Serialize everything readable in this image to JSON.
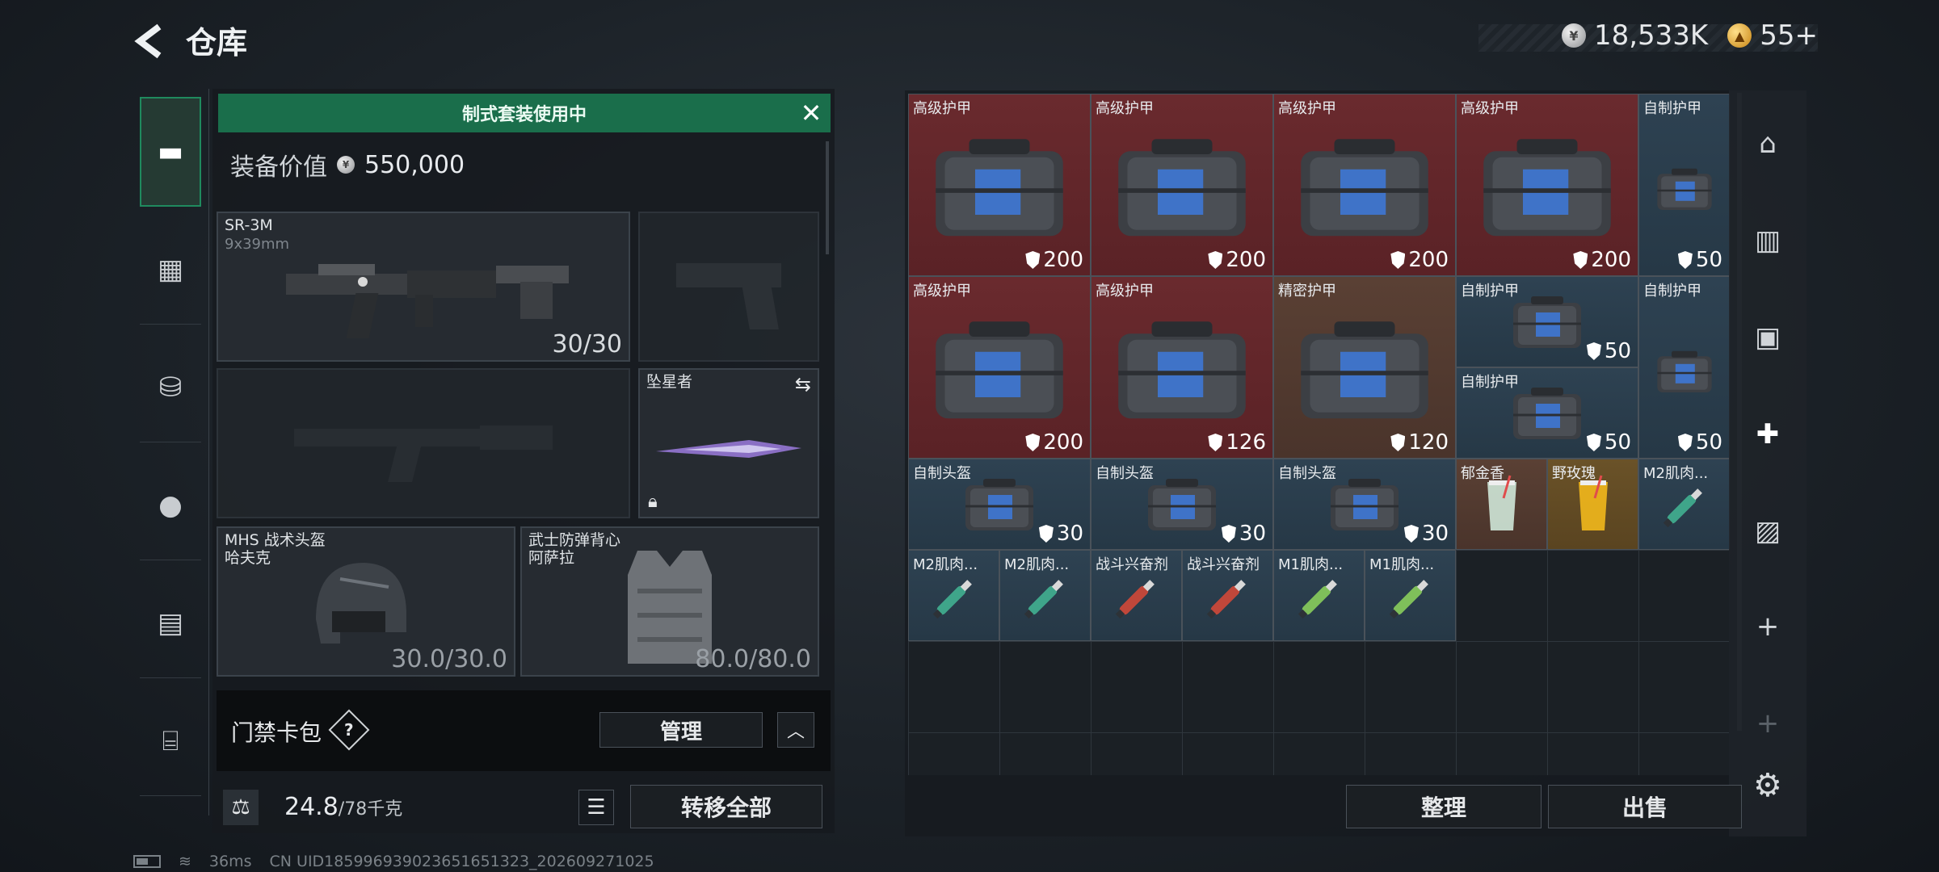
{
  "header": {
    "title": "仓库",
    "silver_amount": "18,533K",
    "gold_amount": "55+"
  },
  "loadout": {
    "kit_banner": "制式套装使用中",
    "value_label": "装备价值",
    "value_amount": "550,000",
    "primary_weapon": {
      "name": "SR-3M",
      "caliber": "9x39mm",
      "ammo": "30/30"
    },
    "melee": {
      "name": "坠星者"
    },
    "helmet": {
      "name": "MHS 战术头盔",
      "sub": "哈夫克",
      "durability": "30.0/30.0"
    },
    "vest": {
      "name": "武士防弹背心",
      "sub": "阿萨拉",
      "durability": "80.0/80.0"
    },
    "card_pack_label": "门禁卡包",
    "card_help": "?",
    "manage_label": "管理",
    "weight_value": "24.8",
    "weight_capacity": "/78千克",
    "transfer_all_label": "转移全部"
  },
  "stash": {
    "items": [
      {
        "name": "高级护甲",
        "durability": "200",
        "rarity": "red"
      },
      {
        "name": "高级护甲",
        "durability": "200",
        "rarity": "red"
      },
      {
        "name": "高级护甲",
        "durability": "200",
        "rarity": "red"
      },
      {
        "name": "高级护甲",
        "durability": "200",
        "rarity": "red"
      },
      {
        "name": "自制护甲",
        "durability": "50",
        "rarity": "blue"
      },
      {
        "name": "高级护甲",
        "durability": "200",
        "rarity": "red"
      },
      {
        "name": "高级护甲",
        "durability": "126",
        "rarity": "red"
      },
      {
        "name": "精密护甲",
        "durability": "120",
        "rarity": "brown"
      },
      {
        "name": "自制护甲",
        "durability": "50",
        "rarity": "blue"
      },
      {
        "name": "自制护甲",
        "durability": "50",
        "rarity": "blue"
      },
      {
        "name": "自制护甲",
        "durability": "50",
        "rarity": "blue"
      },
      {
        "name": "自制头盔",
        "durability": "30",
        "rarity": "blue"
      },
      {
        "name": "自制头盔",
        "durability": "30",
        "rarity": "blue"
      },
      {
        "name": "自制头盔",
        "durability": "30",
        "rarity": "blue"
      },
      {
        "name": "郁金香",
        "rarity": "brown"
      },
      {
        "name": "野玫瑰",
        "rarity": "yellow"
      },
      {
        "name": "M2肌肉...",
        "rarity": "blue"
      },
      {
        "name": "M2肌肉...",
        "rarity": "blue"
      },
      {
        "name": "M2肌肉...",
        "rarity": "blue"
      },
      {
        "name": "战斗兴奋剂",
        "rarity": "blue"
      },
      {
        "name": "战斗兴奋剂",
        "rarity": "blue"
      },
      {
        "name": "M1肌肉...",
        "rarity": "blue"
      },
      {
        "name": "M1肌肉...",
        "rarity": "blue"
      }
    ],
    "sort_label": "整理",
    "sell_label": "出售"
  },
  "right_rail": {
    "add_label": "+"
  },
  "status_bar": {
    "ping": "36ms",
    "uid": "CN UID1859969390236516513​23_202609271025"
  },
  "colors": {
    "accent": "#1a6e4b",
    "red_rarity": "#6a2a2e",
    "blue_rarity": "#2e4252",
    "gold_rarity": "#6a5228"
  }
}
